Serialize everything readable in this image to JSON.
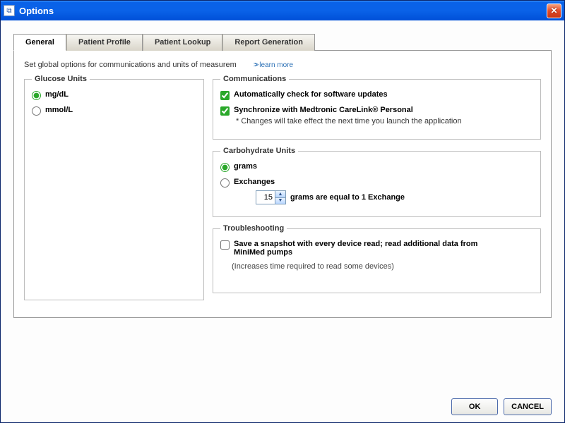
{
  "window": {
    "title": "Options"
  },
  "tabs": [
    {
      "label": "General"
    },
    {
      "label": "Patient Profile"
    },
    {
      "label": "Patient Lookup"
    },
    {
      "label": "Report Generation"
    }
  ],
  "general": {
    "description": "Set global options for communications and units of measurem",
    "learn_more": "learn more",
    "glucose": {
      "legend": "Glucose Units",
      "mgdl": "mg/dL",
      "mmol": "mmol/L"
    },
    "communications": {
      "legend": "Communications",
      "auto_update": "Automatically check for software updates",
      "sync": "Synchronize with Medtronic CareLink® Personal",
      "sync_note": "* Changes will take effect the next time you launch the application"
    },
    "carb": {
      "legend": "Carbohydrate Units",
      "grams": "grams",
      "exchanges": "Exchanges",
      "spin_value": "15",
      "spin_label": "grams are equal to 1 Exchange"
    },
    "trouble": {
      "legend": "Troubleshooting",
      "snapshot": "Save a snapshot with every device read; read additional data from MiniMed pumps",
      "note": "(Increases time required to read some devices)"
    }
  },
  "buttons": {
    "ok": "OK",
    "cancel": "CANCEL"
  }
}
